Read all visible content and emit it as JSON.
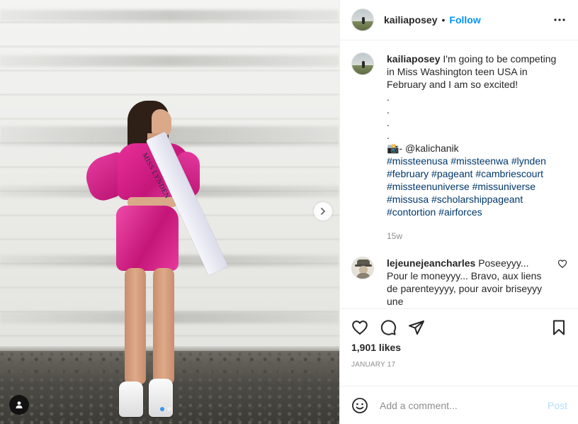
{
  "header": {
    "username": "kailiaposey",
    "separator": "•",
    "follow_label": "Follow"
  },
  "photo": {
    "sash_text": "MISS LYNDEN",
    "carousel_count": 2,
    "carousel_active_index": 0
  },
  "caption": {
    "username": "kailiaposey",
    "text": "I'm going to be competing in Miss Washington teen USA in February and I am so excited!",
    "dot_lines": [
      ".",
      ".",
      ".",
      "."
    ],
    "credit": "📸- @kalichanik",
    "hashtag_lines": [
      "#missteenusa #missteenwa #lynden",
      "#february #pageant #cambriescourt",
      "#missteenuniverse #missuniverse",
      "#missusa #scholarshippageant",
      "#contortion #airforces"
    ],
    "time": "15w"
  },
  "comments": [
    {
      "username": "lejeunejeancharles",
      "text": "Poseeyyy... Pour le moneyyy... Bravo, aux liens de parenteyyyy, pour avoir briseyyy une"
    }
  ],
  "engagement": {
    "likes": "1,901 likes",
    "date": "JANUARY 17"
  },
  "add_comment": {
    "placeholder": "Add a comment...",
    "post_label": "Post"
  },
  "icons": {
    "more": "more-horizontal-icon",
    "next": "chevron-right-icon",
    "tag": "user-tag-icon",
    "like": "heart-icon",
    "comment": "comment-icon",
    "share": "share-icon",
    "save": "bookmark-icon",
    "emoji": "emoji-icon"
  },
  "colors": {
    "accent": "#0095f6",
    "post_disabled": "#b2dffc",
    "secondary_text": "#8e8e8e",
    "hashtag": "#00376b",
    "dress": "#d81e8a"
  }
}
